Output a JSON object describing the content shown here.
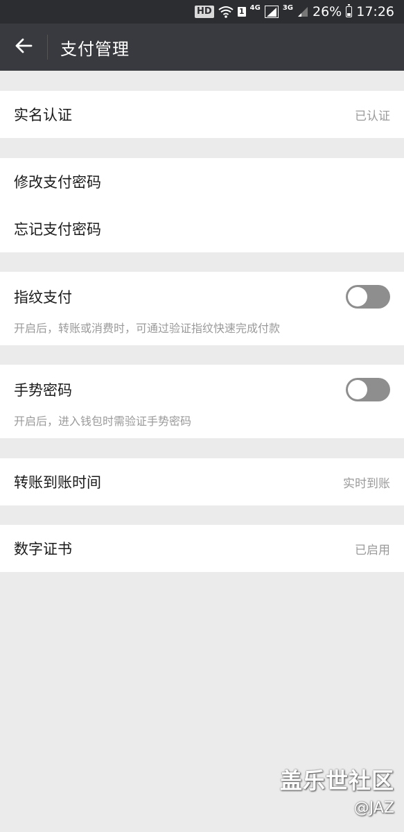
{
  "status_bar": {
    "hd": "HD",
    "sim": "1",
    "net1": "4G",
    "net2": "3G",
    "battery_pct": "26%",
    "time": "17:26"
  },
  "header": {
    "title": "支付管理",
    "back_icon": "arrow-left-icon"
  },
  "groups": {
    "realname": {
      "label": "实名认证",
      "value": "已认证"
    },
    "password": {
      "change_label": "修改支付密码",
      "forgot_label": "忘记支付密码"
    },
    "fingerprint": {
      "label": "指纹支付",
      "desc": "开启后，转账或消费时，可通过验证指纹快速完成付款",
      "enabled": false
    },
    "gesture": {
      "label": "手势密码",
      "desc": "开启后，进入钱包时需验证手势密码",
      "enabled": false
    },
    "transfer": {
      "label": "转账到账时间",
      "value": "实时到账"
    },
    "certificate": {
      "label": "数字证书",
      "value": "已启用"
    }
  },
  "watermark": {
    "brand": "盖乐世社区",
    "user": "@JAZ"
  },
  "colors": {
    "status_bar_bg": "#2c2d31",
    "title_bar_bg": "#393a3f",
    "page_bg": "#ebebeb",
    "toggle_off": "#8e8e8e"
  }
}
